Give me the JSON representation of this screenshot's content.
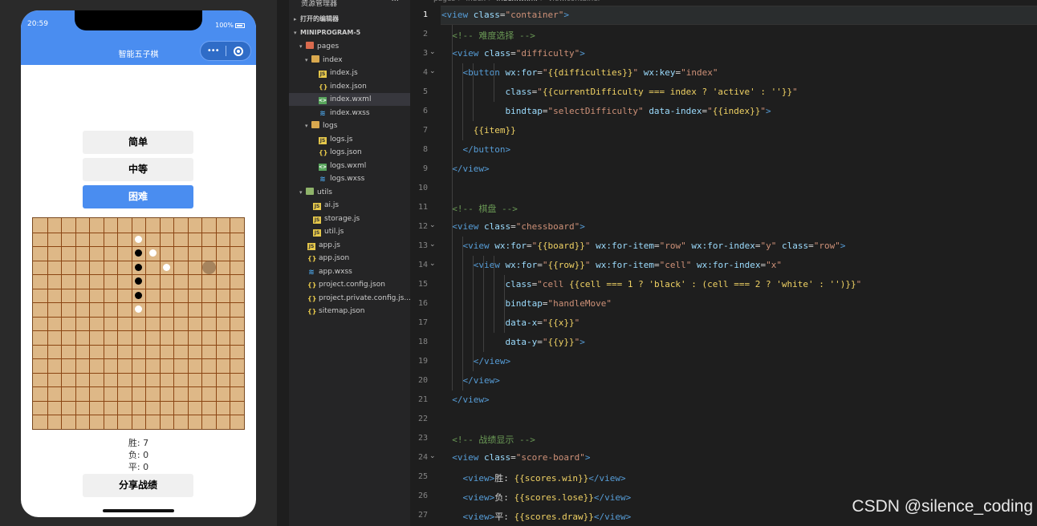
{
  "simulator": {
    "time": "20:59",
    "battery": "100%",
    "nav_title": "智能五子棋",
    "capsule_menu": "•••",
    "difficulties": [
      {
        "label": "简单",
        "active": false
      },
      {
        "label": "中等",
        "active": false
      },
      {
        "label": "困难",
        "active": true
      }
    ],
    "board": {
      "size": 15,
      "black_stones": [
        [
          7,
          2
        ],
        [
          7,
          3
        ],
        [
          7,
          4
        ],
        [
          7,
          5
        ]
      ],
      "white_stones": [
        [
          7,
          1
        ],
        [
          8,
          2
        ],
        [
          9,
          3
        ],
        [
          7,
          6
        ]
      ],
      "hover": [
        12,
        3
      ]
    },
    "scores": {
      "win": "胜: 7",
      "lose": "负: 0",
      "draw": "平: 0"
    },
    "share_label": "分享战绩"
  },
  "explorer": {
    "title": "资源管理器",
    "more": "···",
    "open_editors": "打开的编辑器",
    "project": "MINIPROGRAM-5",
    "items": [
      {
        "label": "pages",
        "type": "folder-red",
        "arrow": "▾"
      },
      {
        "label": "index",
        "type": "folder",
        "arrow": "▾"
      },
      {
        "label": "index.js",
        "type": "js"
      },
      {
        "label": "index.json",
        "type": "json"
      },
      {
        "label": "index.wxml",
        "type": "wxml",
        "selected": true
      },
      {
        "label": "index.wxss",
        "type": "wxss"
      },
      {
        "label": "logs",
        "type": "folder",
        "arrow": "▾"
      },
      {
        "label": "logs.js",
        "type": "js"
      },
      {
        "label": "logs.json",
        "type": "json"
      },
      {
        "label": "logs.wxml",
        "type": "wxml"
      },
      {
        "label": "logs.wxss",
        "type": "wxss"
      },
      {
        "label": "utils",
        "type": "folder-green",
        "arrow": "▾"
      },
      {
        "label": "ai.js",
        "type": "js"
      },
      {
        "label": "storage.js",
        "type": "js"
      },
      {
        "label": "util.js",
        "type": "js"
      },
      {
        "label": "app.js",
        "type": "js"
      },
      {
        "label": "app.json",
        "type": "json"
      },
      {
        "label": "app.wxss",
        "type": "wxss"
      },
      {
        "label": "project.config.json",
        "type": "json"
      },
      {
        "label": "project.private.config.js...",
        "type": "json"
      },
      {
        "label": "sitemap.json",
        "type": "json"
      }
    ]
  },
  "editor": {
    "breadcrumb": [
      "pages",
      "index",
      "index.wxml",
      "view.container"
    ],
    "current_line": 1,
    "lines": [
      "<view class=\"container\">",
      "  <!-- 难度选择 -->",
      "  <view class=\"difficulty\">",
      "    <button wx:for=\"{{difficulties}}\" wx:key=\"index\"",
      "            class=\"{{currentDifficulty === index ? 'active' : ''}}\"",
      "            bindtap=\"selectDifficulty\" data-index=\"{{index}}\">",
      "      {{item}}",
      "    </button>",
      "  </view>",
      "",
      "  <!-- 棋盘 -->",
      "  <view class=\"chessboard\">",
      "    <view wx:for=\"{{board}}\" wx:for-item=\"row\" wx:for-index=\"y\" class=\"row\">",
      "      <view wx:for=\"{{row}}\" wx:for-item=\"cell\" wx:for-index=\"x\"",
      "            class=\"cell {{cell === 1 ? 'black' : (cell === 2 ? 'white' : '')}}\"",
      "            bindtap=\"handleMove\"",
      "            data-x=\"{{x}}\"",
      "            data-y=\"{{y}}\">",
      "      </view>",
      "    </view>",
      "  </view>",
      "",
      "  <!-- 战绩显示 -->",
      "  <view class=\"score-board\">",
      "    <view>胜: {{scores.win}}</view>",
      "    <view>负: {{scores.lose}}</view>",
      "    <view>平: {{scores.draw}}</view>"
    ],
    "folds": [
      3,
      4,
      12,
      13,
      14,
      24
    ]
  },
  "watermark": "CSDN @silence_coding"
}
